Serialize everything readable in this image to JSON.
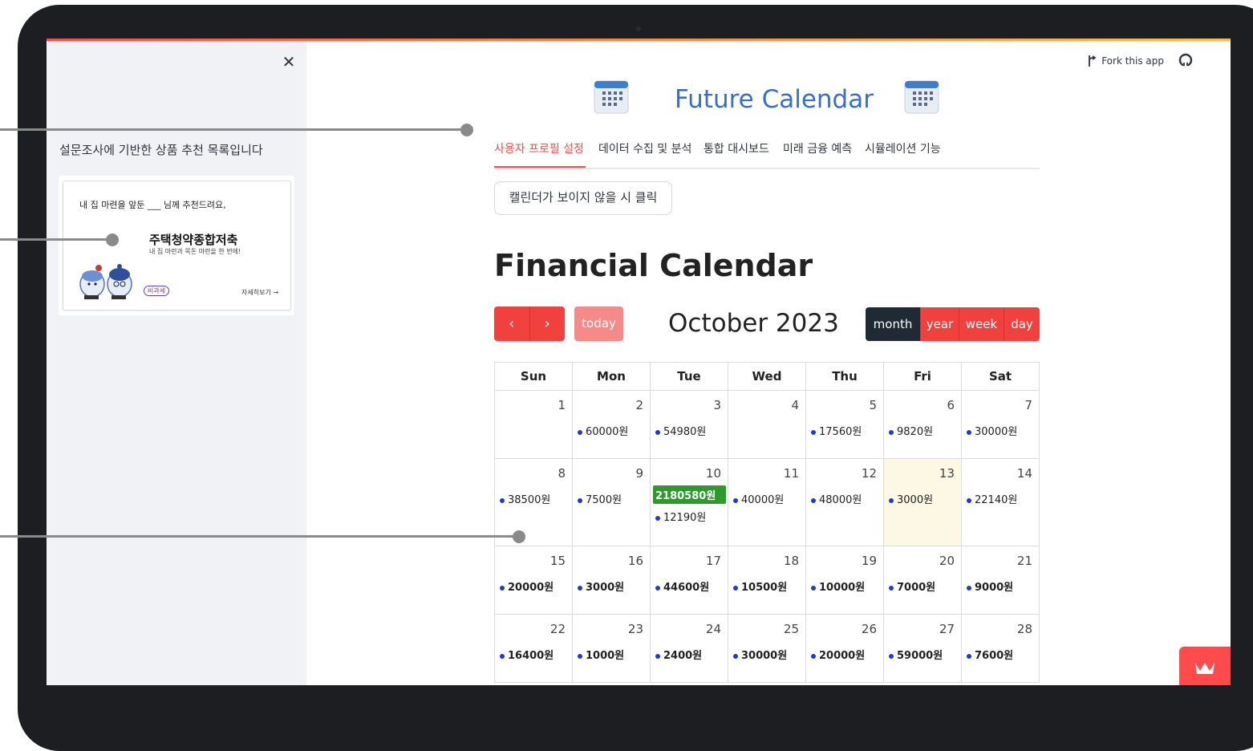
{
  "app": {
    "title": "Future Calendar",
    "fork_label": "Fork this app"
  },
  "sidebar": {
    "title": "설문조사에 기반한 상품 추천 목록입니다",
    "card": {
      "intro": "내 집 마련을 앞둔 ___ 님께 추천드려요,",
      "product_name": "주택청약종합저축",
      "product_desc": "내 집 마련과 목돈 마련을 한 번에!",
      "badge": "비과세",
      "more_link": "자세히보기 →"
    }
  },
  "tabs": [
    {
      "label": "사용자 프로필 설정",
      "active": true
    },
    {
      "label": "데이터 수집 및 분석",
      "active": false
    },
    {
      "label": "통합 대시보드",
      "active": false
    },
    {
      "label": "미래 금융 예측",
      "active": false
    },
    {
      "label": "시뮬레이션 기능",
      "active": false
    }
  ],
  "reload_button": "캘린더가 보이지 않을 시 클릭",
  "calendar": {
    "heading": "Financial Calendar",
    "prev_icon": "‹",
    "next_icon": "›",
    "today_label": "today",
    "month_title": "October 2023",
    "views": [
      "month",
      "year",
      "week",
      "day"
    ],
    "active_view": "month",
    "weekdays": [
      "Sun",
      "Mon",
      "Tue",
      "Wed",
      "Thu",
      "Fri",
      "Sat"
    ],
    "today_date": 13,
    "accent_color": "#f0413f",
    "event_dot_color": "#2436d6",
    "highlight_event_color": "#2e9a2e",
    "weeks": [
      [
        {
          "day": "1",
          "events": []
        },
        {
          "day": "2",
          "events": [
            "60000원"
          ]
        },
        {
          "day": "3",
          "events": [
            "54980원"
          ]
        },
        {
          "day": "4",
          "events": []
        },
        {
          "day": "5",
          "events": [
            "17560원"
          ]
        },
        {
          "day": "6",
          "events": [
            "9820원"
          ]
        },
        {
          "day": "7",
          "events": [
            "30000원"
          ]
        }
      ],
      [
        {
          "day": "8",
          "events": [
            "38500원"
          ]
        },
        {
          "day": "9",
          "events": [
            "7500원"
          ]
        },
        {
          "day": "10",
          "events": [
            "2180580원",
            "12190원"
          ],
          "highlight": "2180580원"
        },
        {
          "day": "11",
          "events": [
            "40000원"
          ]
        },
        {
          "day": "12",
          "events": [
            "48000원"
          ]
        },
        {
          "day": "13",
          "events": [
            "3000원"
          ]
        },
        {
          "day": "14",
          "events": [
            "22140원"
          ]
        }
      ],
      [
        {
          "day": "15",
          "events": [
            "20000원"
          ]
        },
        {
          "day": "16",
          "events": [
            "3000원"
          ]
        },
        {
          "day": "17",
          "events": [
            "44600원"
          ]
        },
        {
          "day": "18",
          "events": [
            "10500원"
          ]
        },
        {
          "day": "19",
          "events": [
            "10000원"
          ]
        },
        {
          "day": "20",
          "events": [
            "7000원"
          ]
        },
        {
          "day": "21",
          "events": [
            "9000원"
          ]
        }
      ],
      [
        {
          "day": "22",
          "events": [
            "16400원"
          ]
        },
        {
          "day": "23",
          "events": [
            "1000원"
          ]
        },
        {
          "day": "24",
          "events": [
            "2400원"
          ]
        },
        {
          "day": "25",
          "events": [
            "30000원"
          ]
        },
        {
          "day": "26",
          "events": [
            "20000원"
          ]
        },
        {
          "day": "27",
          "events": [
            "59000원"
          ]
        },
        {
          "day": "28",
          "events": [
            "7600원"
          ]
        }
      ]
    ]
  }
}
